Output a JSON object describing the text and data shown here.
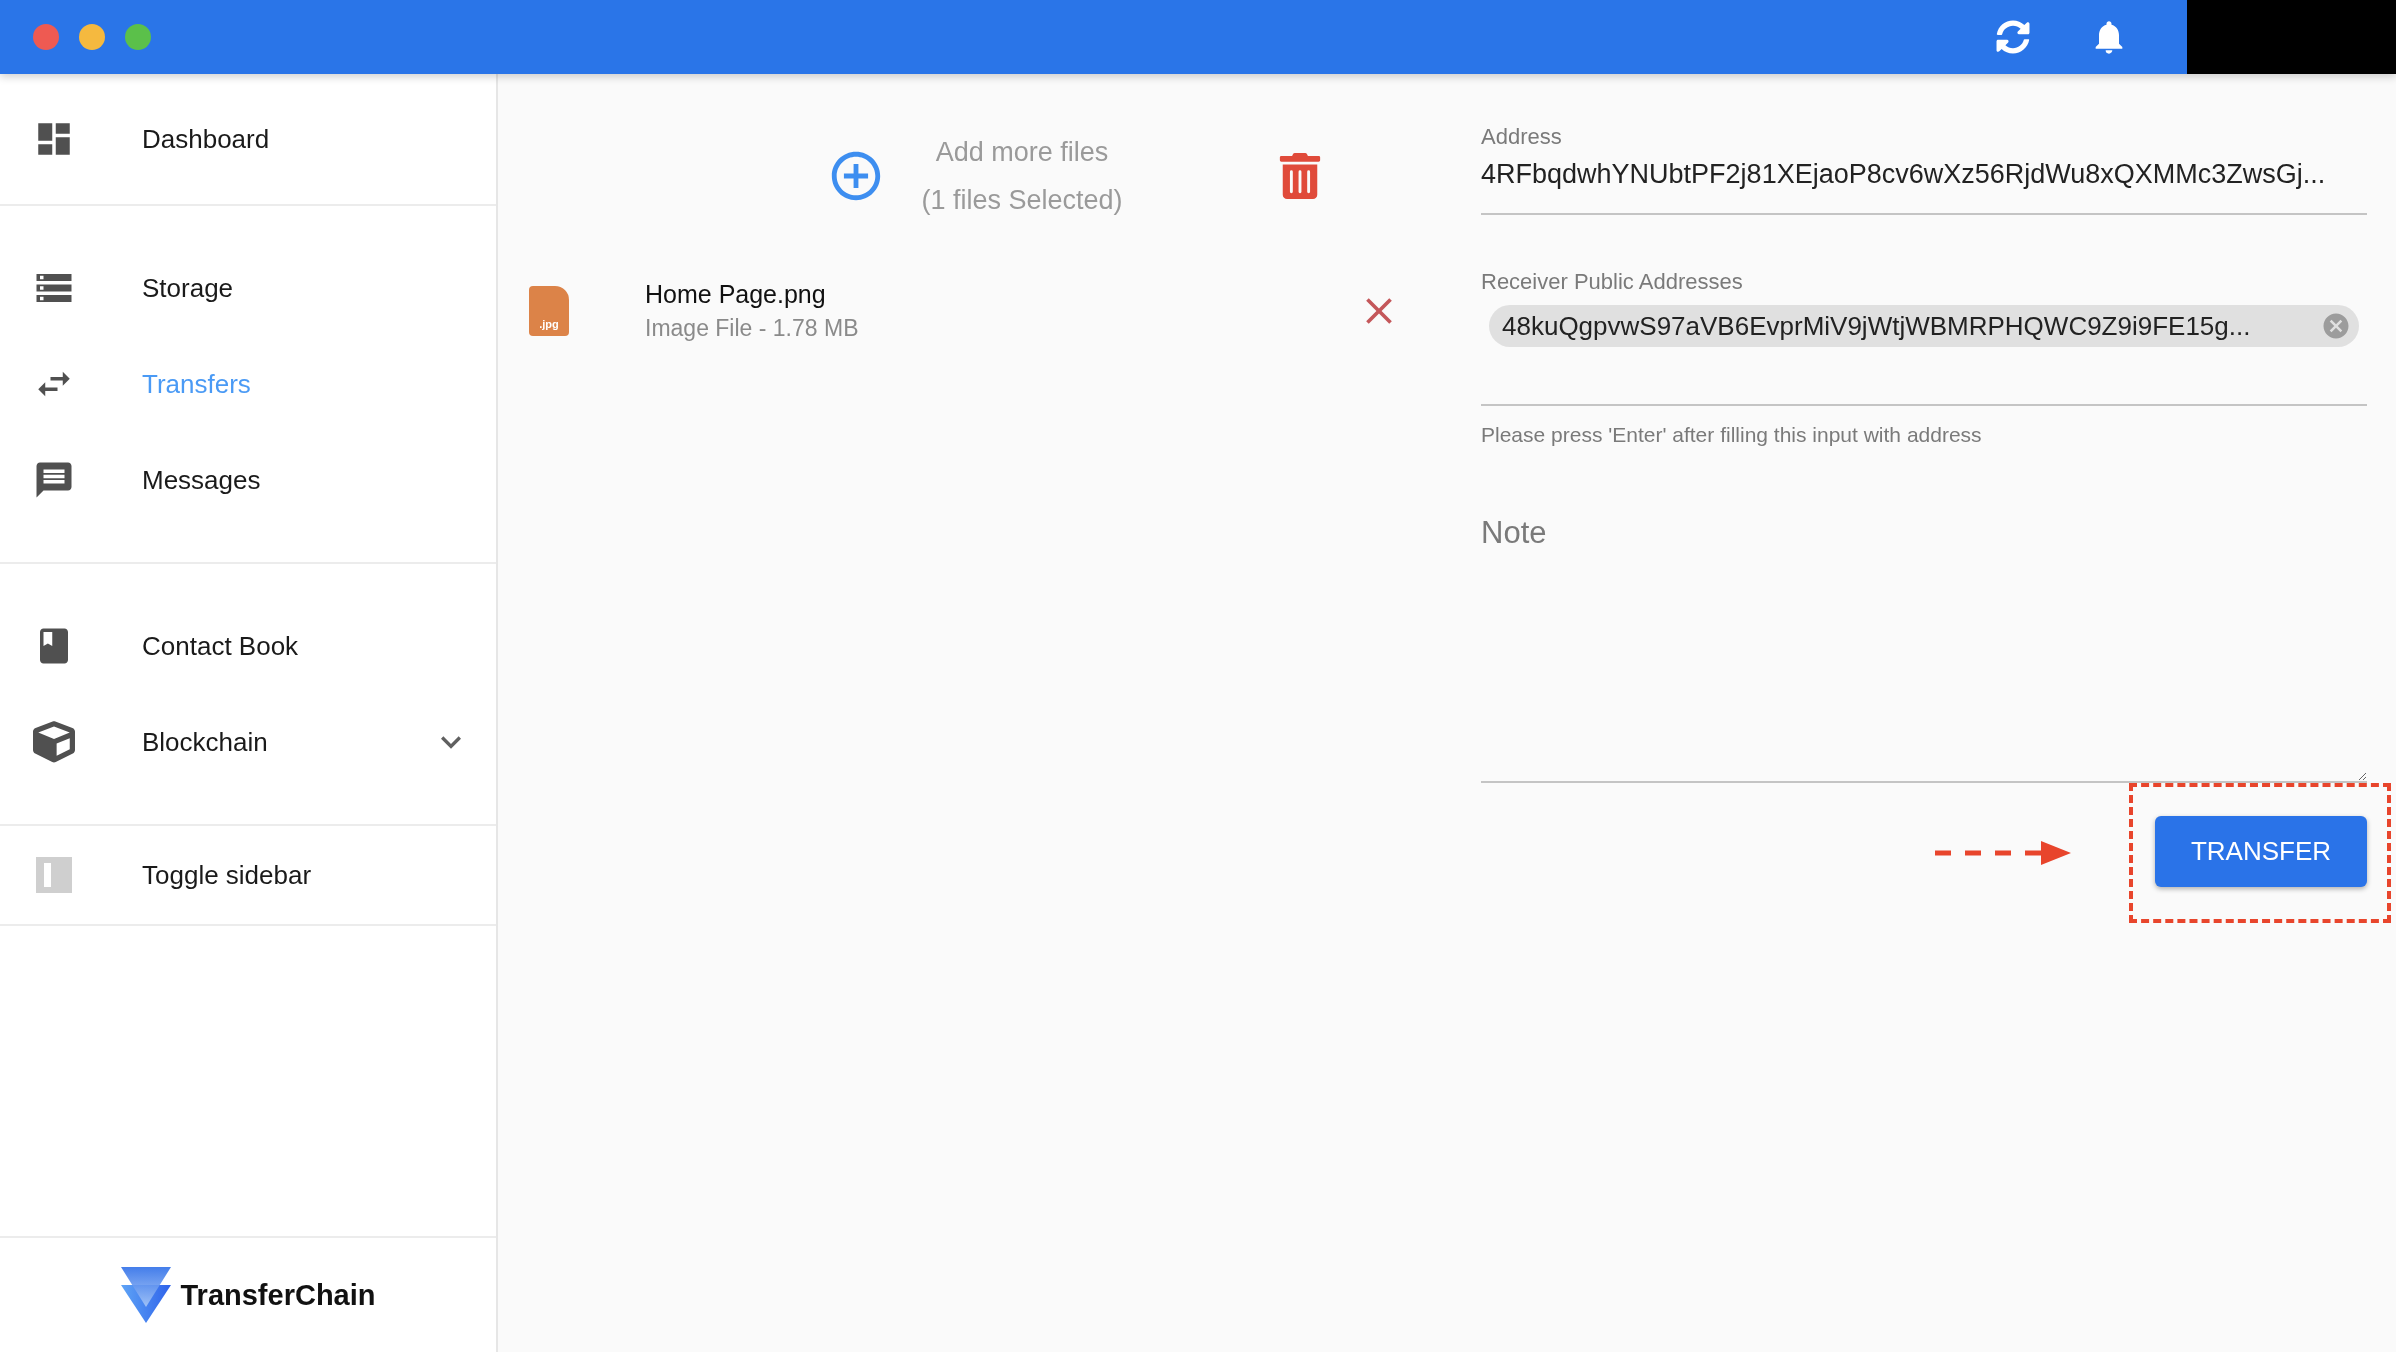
{
  "sidebar": {
    "sections": [
      {
        "items": [
          {
            "label": "Dashboard",
            "selected": false,
            "kind": "link"
          }
        ]
      },
      {
        "items": [
          {
            "label": "Storage",
            "selected": false,
            "kind": "link"
          },
          {
            "label": "Transfers",
            "selected": true,
            "kind": "link"
          },
          {
            "label": "Messages",
            "selected": false,
            "kind": "link"
          }
        ]
      },
      {
        "items": [
          {
            "label": "Contact Book",
            "selected": false,
            "kind": "link"
          },
          {
            "label": "Blockchain",
            "selected": false,
            "kind": "expandable"
          }
        ]
      },
      {
        "items": [
          {
            "label": "Toggle sidebar",
            "selected": false,
            "kind": "toggle"
          }
        ]
      }
    ],
    "logo": "TransferChain"
  },
  "uploader": {
    "add_label": "Add more files",
    "count_label": "(1 files Selected)"
  },
  "files": [
    {
      "name": "Home Page.png",
      "info": "Image File - 1.78 MB",
      "badge": ".jpg"
    }
  ],
  "form": {
    "address_label": "Address",
    "address_value": "4RFbqdwhYNUbtPF2j81XEjaoP8cv6wXz56RjdWu8xQXMMc3ZwsGj...",
    "receivers_label": "Receiver Public Addresses",
    "receivers": [
      "48kuQgpvwS97aVB6EvprMiV9jWtjWBMRPHQWC9Z9i9FE15g..."
    ],
    "hint": "Please press 'Enter' after filling this input with address",
    "note_placeholder": "Note",
    "submit": "TRANSFER"
  }
}
